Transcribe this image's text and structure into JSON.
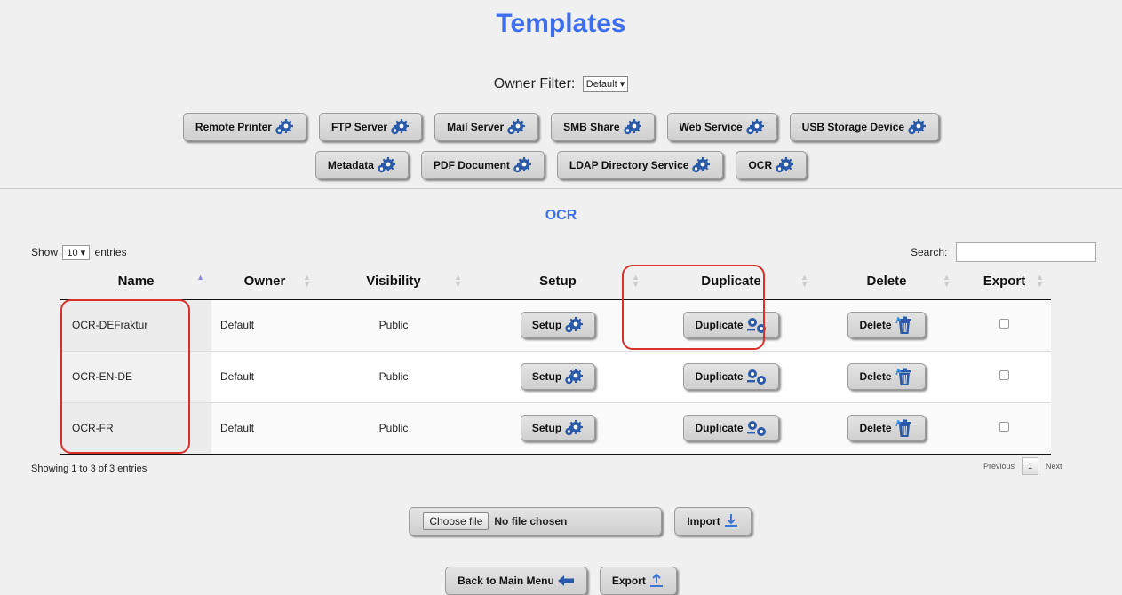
{
  "page": {
    "title": "Templates"
  },
  "owner_filter": {
    "label": "Owner Filter:",
    "value": "Default"
  },
  "template_types": {
    "row1": [
      {
        "label": "Remote Printer"
      },
      {
        "label": "FTP Server"
      },
      {
        "label": "Mail Server"
      },
      {
        "label": "SMB Share"
      },
      {
        "label": "Web Service"
      },
      {
        "label": "USB Storage Device"
      }
    ],
    "row2": [
      {
        "label": "Metadata"
      },
      {
        "label": "PDF Document"
      },
      {
        "label": "LDAP Directory Service"
      },
      {
        "label": "OCR"
      }
    ]
  },
  "section": {
    "title": "OCR"
  },
  "table_controls": {
    "show_prefix": "Show",
    "entries_value": "10",
    "show_suffix": "entries",
    "search_label": "Search:",
    "search_value": ""
  },
  "table": {
    "columns": [
      "Name",
      "Owner",
      "Visibility",
      "Setup",
      "Duplicate",
      "Delete",
      "Export"
    ],
    "rows": [
      {
        "name": "OCR-DEFraktur",
        "owner": "Default",
        "visibility": "Public",
        "setup": "Setup",
        "duplicate": "Duplicate",
        "delete": "Delete",
        "export_checked": false
      },
      {
        "name": "OCR-EN-DE",
        "owner": "Default",
        "visibility": "Public",
        "setup": "Setup",
        "duplicate": "Duplicate",
        "delete": "Delete",
        "export_checked": false
      },
      {
        "name": "OCR-FR",
        "owner": "Default",
        "visibility": "Public",
        "setup": "Setup",
        "duplicate": "Duplicate",
        "delete": "Delete",
        "export_checked": false
      }
    ]
  },
  "table_footer": {
    "info": "Showing 1 to 3 of 3 entries",
    "previous": "Previous",
    "page": "1",
    "next": "Next"
  },
  "import": {
    "choose_label": "Choose file",
    "file_status": "No file chosen",
    "import_label": "Import"
  },
  "footer": {
    "back_label": "Back to Main Menu",
    "export_label": "Export"
  },
  "colors": {
    "accent": "#3d6ef0",
    "icon": "#2a5aa8",
    "highlight": "#d9302b"
  }
}
